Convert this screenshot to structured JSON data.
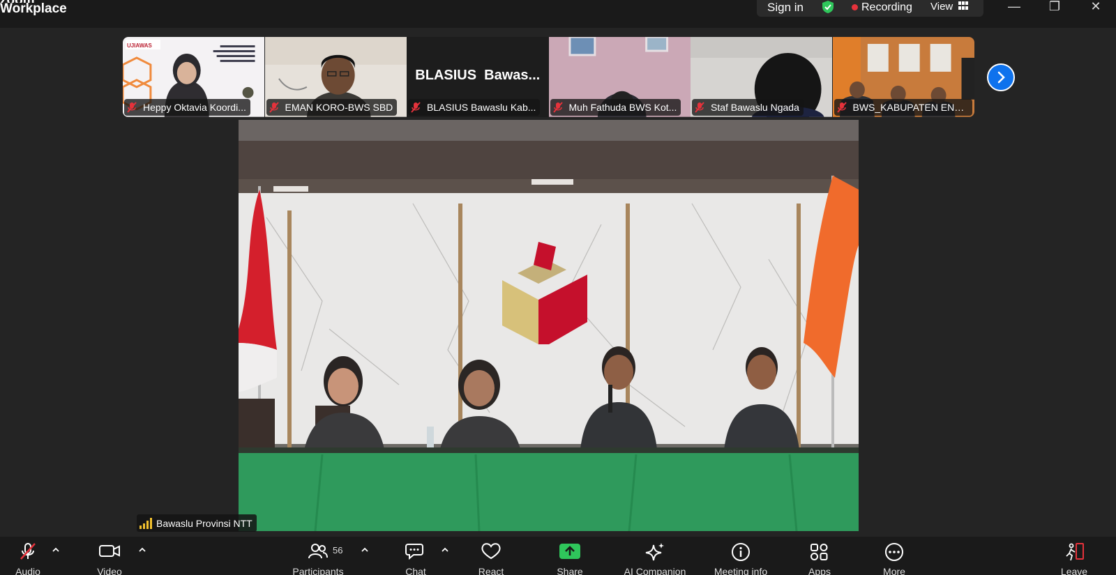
{
  "titlebar": {
    "brand_line1": "zoom",
    "brand_line2": "Workplace",
    "sign_in": "Sign in",
    "recording": "Recording",
    "view": "View",
    "colors": {
      "shield": "#2fc65b",
      "record_dot": "#e5323b"
    }
  },
  "window_controls": {
    "minimize": "—",
    "restore": "❐",
    "close": "✕"
  },
  "thumbnails": [
    {
      "name": "Heppy Oktavia Koordi...",
      "icon": "mic-muted-icon"
    },
    {
      "name": "EMAN KORO-BWS SBD",
      "icon": "mic-muted-icon"
    },
    {
      "name": "BLASIUS Bawaslu Kab...",
      "icon": "mic-muted-icon",
      "display_text": "BLASIUS  Bawas..."
    },
    {
      "name": "Muh Fathuda BWS Kot...",
      "icon": "mic-muted-icon"
    },
    {
      "name": "Staf Bawaslu Ngada",
      "icon": "mic-muted-icon"
    },
    {
      "name": "BWS_KABUPATEN ENDE",
      "icon": "mic-muted-icon"
    }
  ],
  "main_video": {
    "speaker_name": "Bawaslu Provinsi NTT"
  },
  "toolbar": {
    "audio": "Audio",
    "video": "Video",
    "participants": "Participants",
    "participants_count": "56",
    "chat": "Chat",
    "react": "React",
    "share": "Share",
    "ai_companion": "AI Companion",
    "meeting_info": "Meeting info",
    "apps": "Apps",
    "more": "More",
    "leave": "Leave",
    "colors": {
      "share": "#2fc65b",
      "audio_muted": "#e5323b",
      "leave": "#e5323b"
    }
  }
}
